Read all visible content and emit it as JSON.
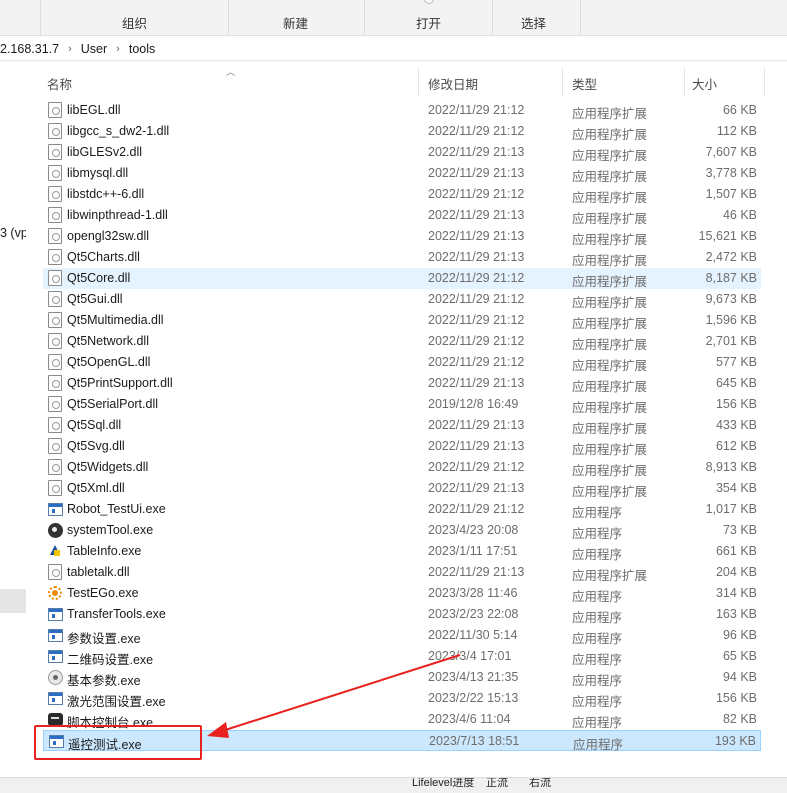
{
  "ribbon": {
    "labels": [
      "组织",
      "新建",
      "打开",
      "选择"
    ]
  },
  "address": {
    "crumbs": [
      "2.168.31.7",
      "User",
      "tools"
    ]
  },
  "nav": {
    "fragment": "3 (vp"
  },
  "columns": {
    "name": "名称",
    "date": "修改日期",
    "type": "类型",
    "size": "大小"
  },
  "files": [
    {
      "name": "libEGL.dll",
      "date": "2022/11/29 21:12",
      "type": "应用程序扩展",
      "size": "66 KB",
      "icon": "dll-file-icon"
    },
    {
      "name": "libgcc_s_dw2-1.dll",
      "date": "2022/11/29 21:12",
      "type": "应用程序扩展",
      "size": "112 KB",
      "icon": "dll-file-icon"
    },
    {
      "name": "libGLESv2.dll",
      "date": "2022/11/29 21:13",
      "type": "应用程序扩展",
      "size": "7,607 KB",
      "icon": "dll-file-icon"
    },
    {
      "name": "libmysql.dll",
      "date": "2022/11/29 21:13",
      "type": "应用程序扩展",
      "size": "3,778 KB",
      "icon": "dll-file-icon"
    },
    {
      "name": "libstdc++-6.dll",
      "date": "2022/11/29 21:12",
      "type": "应用程序扩展",
      "size": "1,507 KB",
      "icon": "dll-file-icon"
    },
    {
      "name": "libwinpthread-1.dll",
      "date": "2022/11/29 21:13",
      "type": "应用程序扩展",
      "size": "46 KB",
      "icon": "dll-file-icon"
    },
    {
      "name": "opengl32sw.dll",
      "date": "2022/11/29 21:13",
      "type": "应用程序扩展",
      "size": "15,621 KB",
      "icon": "dll-file-icon"
    },
    {
      "name": "Qt5Charts.dll",
      "date": "2022/11/29 21:13",
      "type": "应用程序扩展",
      "size": "2,472 KB",
      "icon": "dll-file-icon"
    },
    {
      "name": "Qt5Core.dll",
      "date": "2022/11/29 21:12",
      "type": "应用程序扩展",
      "size": "8,187 KB",
      "icon": "dll-file-icon"
    },
    {
      "name": "Qt5Gui.dll",
      "date": "2022/11/29 21:12",
      "type": "应用程序扩展",
      "size": "9,673 KB",
      "icon": "dll-file-icon"
    },
    {
      "name": "Qt5Multimedia.dll",
      "date": "2022/11/29 21:12",
      "type": "应用程序扩展",
      "size": "1,596 KB",
      "icon": "dll-file-icon"
    },
    {
      "name": "Qt5Network.dll",
      "date": "2022/11/29 21:12",
      "type": "应用程序扩展",
      "size": "2,701 KB",
      "icon": "dll-file-icon"
    },
    {
      "name": "Qt5OpenGL.dll",
      "date": "2022/11/29 21:12",
      "type": "应用程序扩展",
      "size": "577 KB",
      "icon": "dll-file-icon"
    },
    {
      "name": "Qt5PrintSupport.dll",
      "date": "2022/11/29 21:13",
      "type": "应用程序扩展",
      "size": "645 KB",
      "icon": "dll-file-icon"
    },
    {
      "name": "Qt5SerialPort.dll",
      "date": "2019/12/8 16:49",
      "type": "应用程序扩展",
      "size": "156 KB",
      "icon": "dll-file-icon"
    },
    {
      "name": "Qt5Sql.dll",
      "date": "2022/11/29 21:13",
      "type": "应用程序扩展",
      "size": "433 KB",
      "icon": "dll-file-icon"
    },
    {
      "name": "Qt5Svg.dll",
      "date": "2022/11/29 21:13",
      "type": "应用程序扩展",
      "size": "612 KB",
      "icon": "dll-file-icon"
    },
    {
      "name": "Qt5Widgets.dll",
      "date": "2022/11/29 21:12",
      "type": "应用程序扩展",
      "size": "8,913 KB",
      "icon": "dll-file-icon"
    },
    {
      "name": "Qt5Xml.dll",
      "date": "2022/11/29 21:13",
      "type": "应用程序扩展",
      "size": "354 KB",
      "icon": "dll-file-icon"
    },
    {
      "name": "Robot_TestUi.exe",
      "date": "2022/11/29 21:12",
      "type": "应用程序",
      "size": "1,017 KB",
      "icon": "exe-window-icon"
    },
    {
      "name": "systemTool.exe",
      "date": "2023/4/23 20:08",
      "type": "应用程序",
      "size": "73 KB",
      "icon": "round-app-icon"
    },
    {
      "name": "TableInfo.exe",
      "date": "2023/1/11 17:51",
      "type": "应用程序",
      "size": "661 KB",
      "icon": "tableinfo-app-icon"
    },
    {
      "name": "tabletalk.dll",
      "date": "2022/11/29 21:13",
      "type": "应用程序扩展",
      "size": "204 KB",
      "icon": "dll-file-icon"
    },
    {
      "name": "TestEGo.exe",
      "date": "2023/3/28 11:46",
      "type": "应用程序",
      "size": "314 KB",
      "icon": "gear-app-icon"
    },
    {
      "name": "TransferTools.exe",
      "date": "2023/2/23 22:08",
      "type": "应用程序",
      "size": "163 KB",
      "icon": "exe-window-icon"
    },
    {
      "name": "参数设置.exe",
      "date": "2022/11/30 5:14",
      "type": "应用程序",
      "size": "96 KB",
      "icon": "exe-window-icon"
    },
    {
      "name": "二维码设置.exe",
      "date": "2023/3/4 17:01",
      "type": "应用程序",
      "size": "65 KB",
      "icon": "exe-window-icon"
    },
    {
      "name": "基本参数.exe",
      "date": "2023/4/13 21:35",
      "type": "应用程序",
      "size": "94 KB",
      "icon": "round-light-app-icon"
    },
    {
      "name": "激光范围设置.exe",
      "date": "2023/2/22 15:13",
      "type": "应用程序",
      "size": "156 KB",
      "icon": "exe-window-icon"
    },
    {
      "name": "脚本控制台.exe",
      "date": "2023/4/6 11:04",
      "type": "应用程序",
      "size": "82 KB",
      "icon": "console-app-icon"
    },
    {
      "name": "遥控测试.exe",
      "date": "2023/7/13 18:51",
      "type": "应用程序",
      "size": "193 KB",
      "icon": "exe-window-icon"
    }
  ],
  "selected_index": 30,
  "hover_index": 8,
  "bottom": {
    "texts": [
      "Lifelevel进度",
      "正流",
      "右流"
    ]
  },
  "colors": {
    "annotation": "#e8231f",
    "selection": "#cce8ff"
  }
}
